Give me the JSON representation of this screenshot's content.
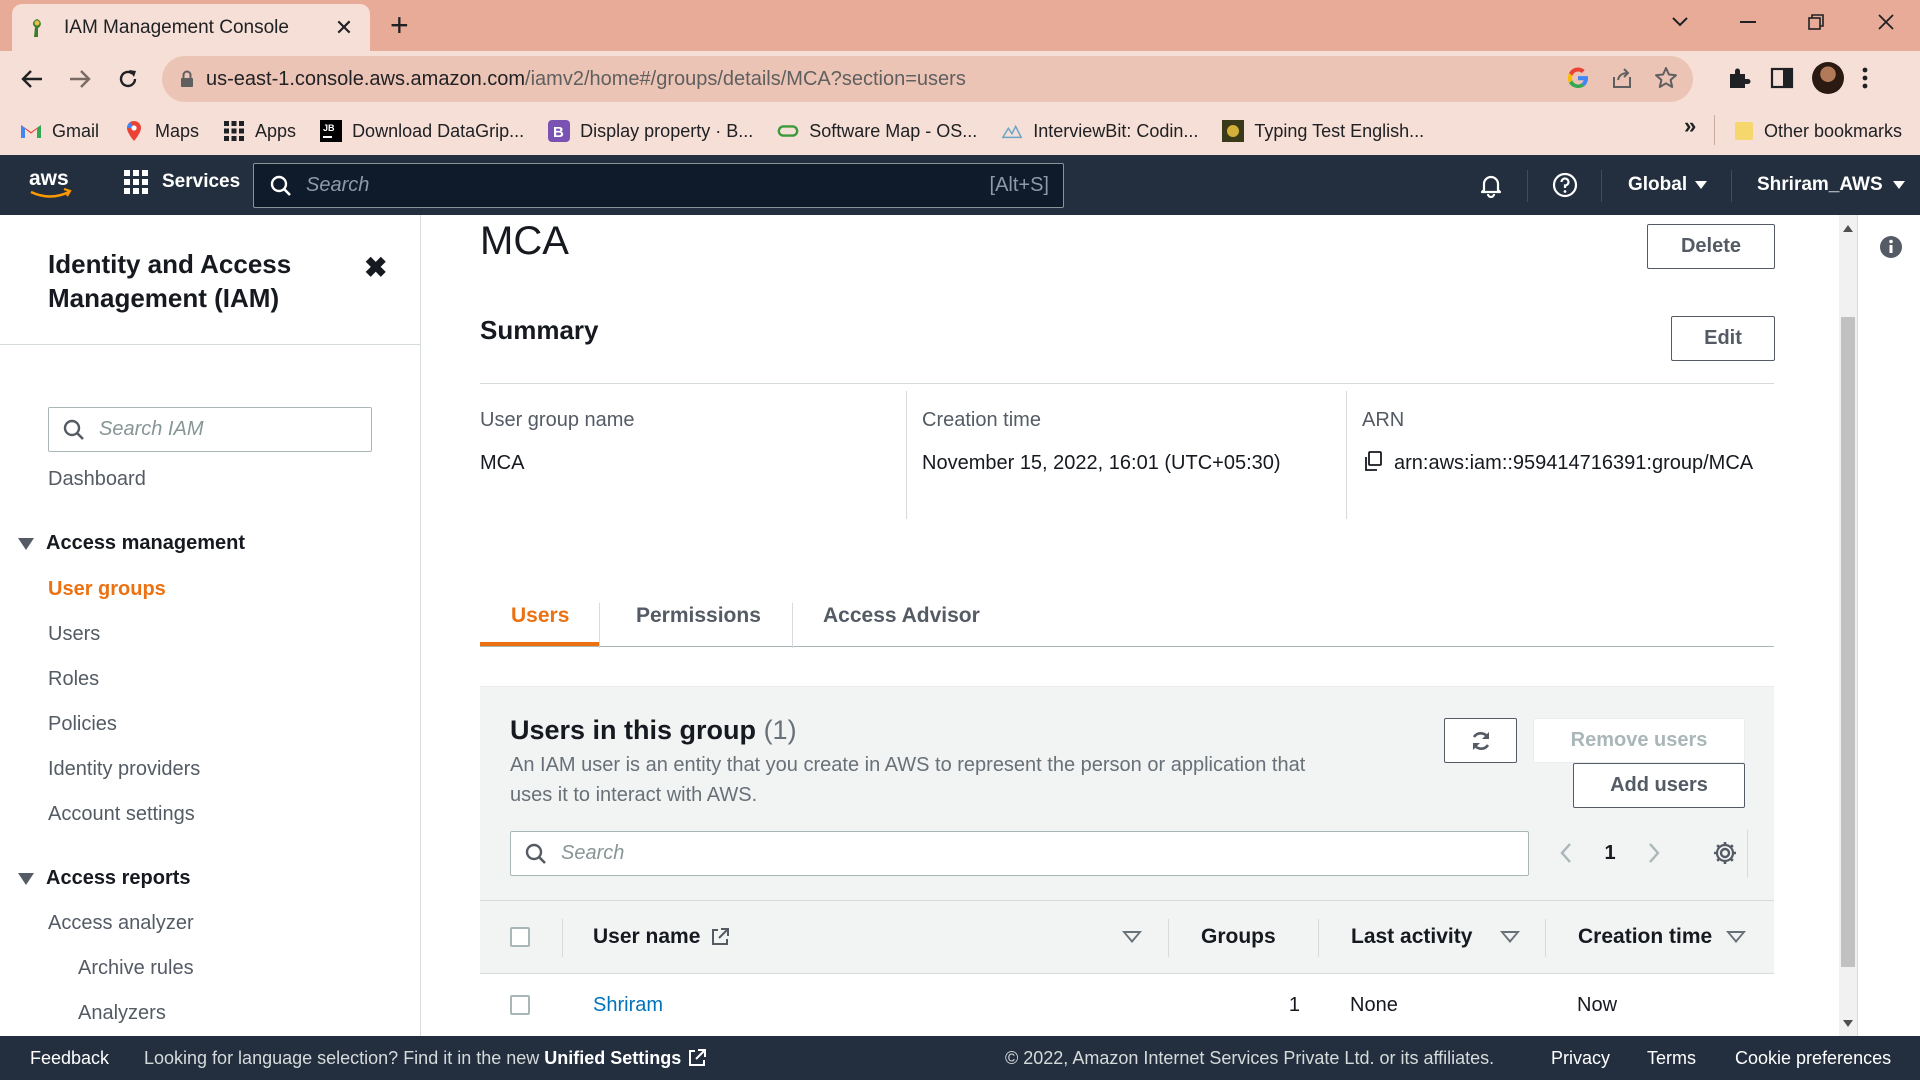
{
  "browser": {
    "tab_title": "IAM Management Console",
    "url_host": "us-east-1.console.aws.amazon.com",
    "url_path": "/iamv2/home#/groups/details/MCA?section=users",
    "bookmarks": [
      {
        "label": "Gmail",
        "icon": "gmail-icon"
      },
      {
        "label": "Maps",
        "icon": "maps-icon"
      },
      {
        "label": "Apps",
        "icon": "apps-grid-icon"
      },
      {
        "label": "Download DataGrip...",
        "icon": "jetbrains-icon"
      },
      {
        "label": "Display property · B...",
        "icon": "bootstrap-icon"
      },
      {
        "label": "Software Map - OS...",
        "icon": "software-map-icon"
      },
      {
        "label": "InterviewBit: Codin...",
        "icon": "interviewbit-icon"
      },
      {
        "label": "Typing Test English...",
        "icon": "typing-test-icon"
      }
    ],
    "bookmarks_overflow": "»",
    "other_bookmarks": "Other bookmarks"
  },
  "awsnav": {
    "services_label": "Services",
    "search_placeholder": "Search",
    "search_shortcut": "[Alt+S]",
    "region": "Global",
    "account": "Shriram_AWS"
  },
  "sidebar": {
    "title": "Identity and Access Management (IAM)",
    "search_placeholder": "Search IAM",
    "dashboard": "Dashboard",
    "access_management": "Access management",
    "items": [
      "User groups",
      "Users",
      "Roles",
      "Policies",
      "Identity providers",
      "Account settings"
    ],
    "access_reports": "Access reports",
    "report_items": [
      "Access analyzer"
    ],
    "sub_items": [
      "Archive rules",
      "Analyzers"
    ]
  },
  "main": {
    "title": "MCA",
    "delete_label": "Delete",
    "summary_title": "Summary",
    "edit_label": "Edit",
    "summary": {
      "group_name_label": "User group name",
      "group_name_value": "MCA",
      "creation_label": "Creation time",
      "creation_value": "November 15, 2022, 16:01 (UTC+05:30)",
      "arn_label": "ARN",
      "arn_value": "arn:aws:iam::959414716391:group/MCA"
    },
    "tabs": [
      "Users",
      "Permissions",
      "Access Advisor"
    ],
    "active_tab": "Users"
  },
  "users_panel": {
    "heading": "Users in this group",
    "count": "(1)",
    "description": "An IAM user is an entity that you create in AWS to represent the person or application that uses it to interact with AWS.",
    "remove_label": "Remove users",
    "add_label": "Add users",
    "search_placeholder": "Search",
    "page": "1",
    "columns": [
      "User name",
      "Groups",
      "Last activity",
      "Creation time"
    ],
    "rows": [
      {
        "user_name": "Shriram",
        "groups": "1",
        "last_activity": "None",
        "creation_time": "Now"
      }
    ]
  },
  "footer": {
    "feedback": "Feedback",
    "language_text": "Looking for language selection? Find it in the new",
    "unified_settings": "Unified Settings",
    "copyright": "© 2022, Amazon Internet Services Private Ltd. or its affiliates.",
    "privacy": "Privacy",
    "terms": "Terms",
    "cookies": "Cookie preferences"
  },
  "colors": {
    "aws_nav": "#232f3e",
    "accent_orange": "#ec7211",
    "link_blue": "#0073bb",
    "browser_frame": "#e8ab98"
  }
}
